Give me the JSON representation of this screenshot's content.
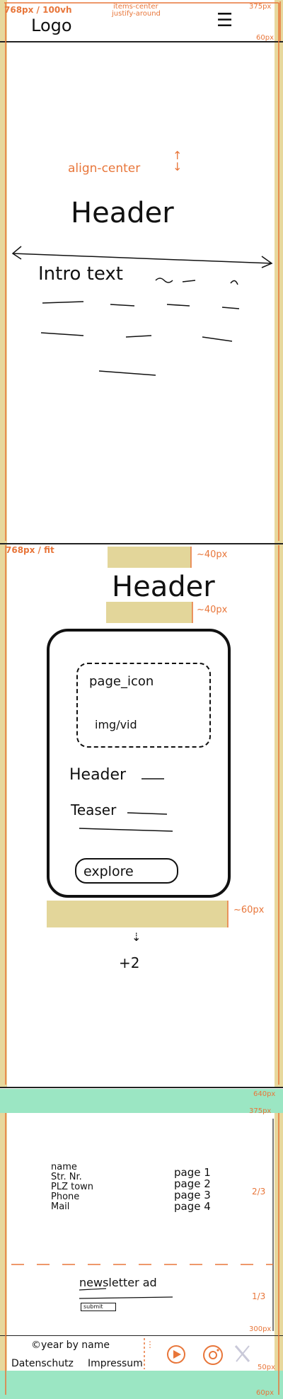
{
  "hero": {
    "height_note": "768px / 100vh",
    "items_note_1": "items-center",
    "items_note_2": "justify-around",
    "width_note": "375px",
    "header_height_note": "60px",
    "logo": "Logo",
    "menu_icon": "hamburger-menu-icon",
    "align_note": "align-center",
    "title": "Header",
    "intro": "Intro text"
  },
  "cards": {
    "height_note": "768px / fit",
    "gap_top_note": "~40px",
    "title": "Header",
    "gap_mid_note": "~40px",
    "card": {
      "icon_label": "page_icon",
      "media_label": "img/vid",
      "header": "Header",
      "teaser": "Teaser",
      "button": "explore"
    },
    "gap_bottom_note": "~60px",
    "more_note": "+2"
  },
  "footer": {
    "height_note": "640px",
    "width_note": "375px",
    "contact": [
      "name",
      "Str. Nr.",
      "PLZ town",
      "Phone",
      "Mail"
    ],
    "pages": [
      "page 1",
      "page 2",
      "page 3",
      "page 4"
    ],
    "ratio_top": "2/3",
    "newsletter": "newsletter ad",
    "submit": "submit",
    "ratio_bottom": "1/3",
    "inner_height_note": "300px",
    "copyright": "©year by name",
    "legal": [
      "Datenschutz",
      "Impressum"
    ],
    "legal_height_note": "50px",
    "bottom_note": "60px",
    "social_icons": [
      "youtube-icon",
      "instagram-icon",
      "x-icon"
    ]
  },
  "colors": {
    "accent": "#e8763a",
    "sand": "#e7d89d",
    "mint": "#9be6c3",
    "ink": "#111111"
  }
}
